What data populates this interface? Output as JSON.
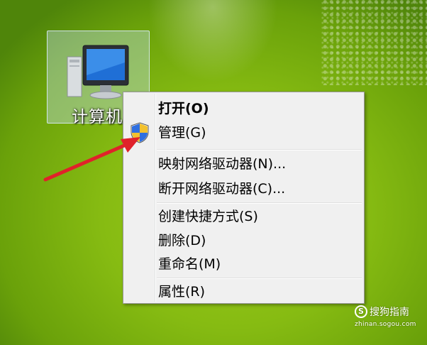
{
  "desktop": {
    "computer_icon": {
      "label": "计算机",
      "icon": "computer-icon"
    }
  },
  "context_menu": {
    "items": [
      {
        "label": "打开(O)",
        "bold": true
      },
      {
        "label": "管理(G)",
        "icon": "uac-shield-icon"
      },
      {
        "label": "映射网络驱动器(N)..."
      },
      {
        "label": "断开网络驱动器(C)..."
      },
      {
        "label": "创建快捷方式(S)"
      },
      {
        "label": "删除(D)"
      },
      {
        "label": "重命名(M)"
      },
      {
        "label": "属性(R)"
      }
    ]
  },
  "annotation": {
    "arrow_color": "#e0222a"
  },
  "watermark": {
    "logo": "S",
    "name": "搜狗指南",
    "url": "zhinan.sogou.com"
  }
}
